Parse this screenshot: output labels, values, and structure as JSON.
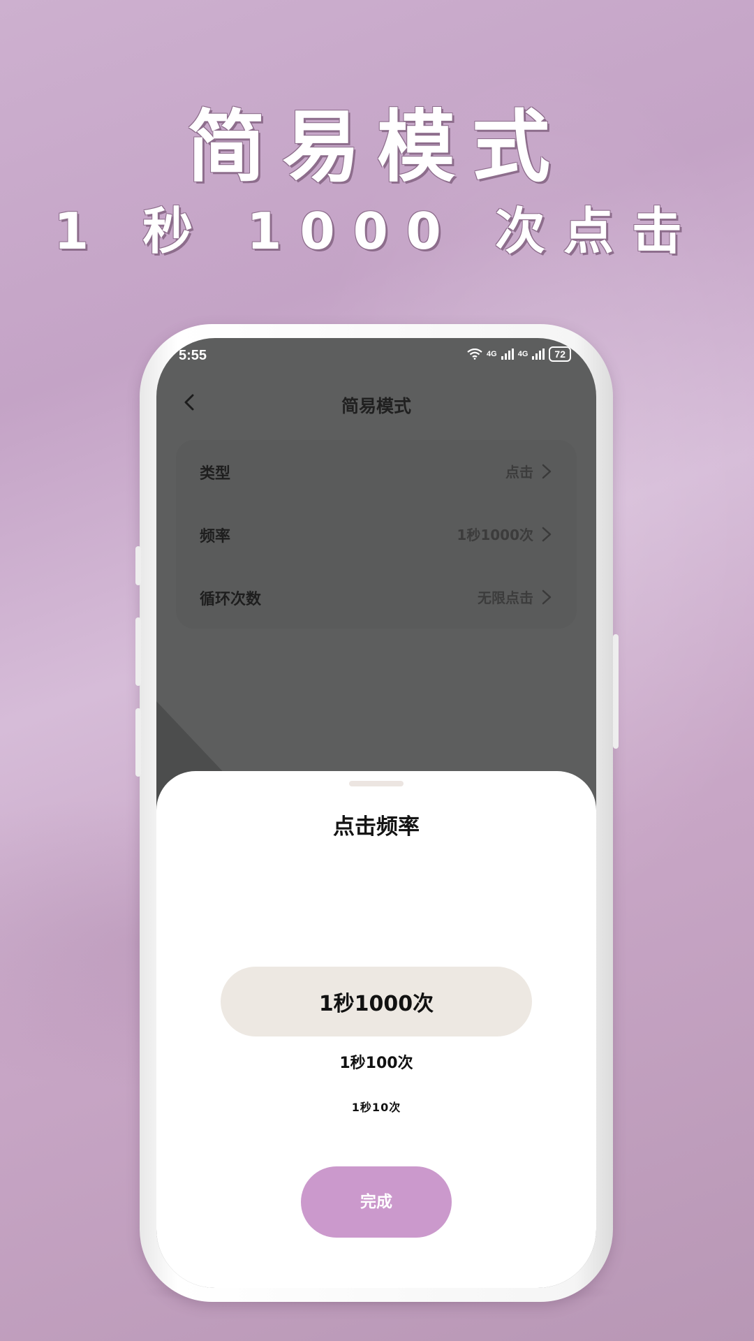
{
  "hero": {
    "title": "简易模式",
    "subtitle": "1 秒 1000 次点击"
  },
  "status_bar": {
    "time": "5:55",
    "network_1": "4G",
    "network_2": "4G",
    "battery": "72"
  },
  "nav": {
    "title": "简易模式",
    "back_icon": "chevron-left-icon"
  },
  "settings": [
    {
      "label": "类型",
      "value": "点击"
    },
    {
      "label": "频率",
      "value": "1秒1000次"
    },
    {
      "label": "循环次数",
      "value": "无限点击"
    }
  ],
  "sheet": {
    "title": "点击频率",
    "options": [
      "1秒1000次",
      "1秒100次",
      "1秒10次"
    ],
    "selected": "1秒1000次",
    "done_label": "完成"
  },
  "colors": {
    "accent": "#cb99cc",
    "picker_highlight": "#ede8e2",
    "background": "#c8a6c6"
  }
}
